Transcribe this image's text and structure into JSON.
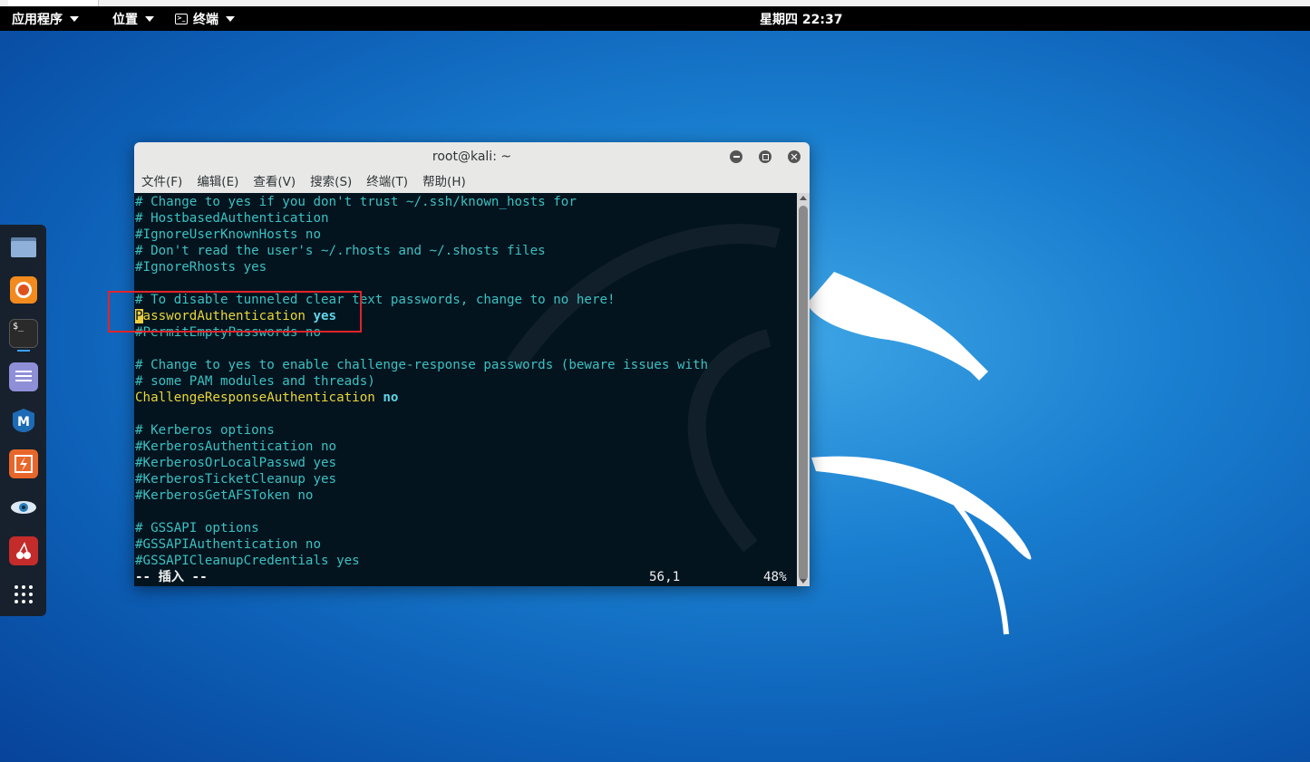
{
  "panel": {
    "apps": "应用程序",
    "places": "位置",
    "terminal": "终端",
    "clock": "星期四 22:37"
  },
  "window": {
    "title": "root@kali: ~",
    "menu": [
      "文件(F)",
      "编辑(E)",
      "查看(V)",
      "搜索(S)",
      "终端(T)",
      "帮助(H)"
    ]
  },
  "terminal_lines": [
    "# Change to yes if you don't trust ~/.ssh/known_hosts for",
    "# HostbasedAuthentication",
    "#IgnoreUserKnownHosts no",
    "# Don't read the user's ~/.rhosts and ~/.shosts files",
    "#IgnoreRhosts yes",
    "",
    "# To disable tunneled clear text passwords, change to no here!",
    "",
    "#PermitEmptyPasswords no",
    "",
    "# Change to yes to enable challenge-response passwords (beware issues with",
    "# some PAM modules and threads)",
    "",
    "",
    "# Kerberos options",
    "#KerberosAuthentication no",
    "#KerberosOrLocalPasswd yes",
    "#KerberosTicketCleanup yes",
    "#KerberosGetAFSToken no",
    "",
    "# GSSAPI options",
    "#GSSAPIAuthentication no",
    "#GSSAPICleanupCredentials yes"
  ],
  "password_line": {
    "cursor_char": "P",
    "key": "asswordAuthentication",
    "value": "yes"
  },
  "challenge_line": {
    "key": "ChallengeResponseAuthentication",
    "value": "no"
  },
  "status": {
    "mode": "-- 插入 --",
    "position": "56,1",
    "percent": "48%"
  },
  "dock": [
    "files-icon",
    "firefox-icon",
    "terminal-icon",
    "notes-icon",
    "metasploit-icon",
    "burpsuite-icon",
    "eye-icon",
    "cherrytree-icon",
    "app-grid-icon"
  ],
  "colors": {
    "comment": "#3bc1c1",
    "keyword": "#e8d638",
    "value": "#5fd5e8",
    "terminal_bg": "#04141f",
    "highlight": "#e0242a"
  }
}
